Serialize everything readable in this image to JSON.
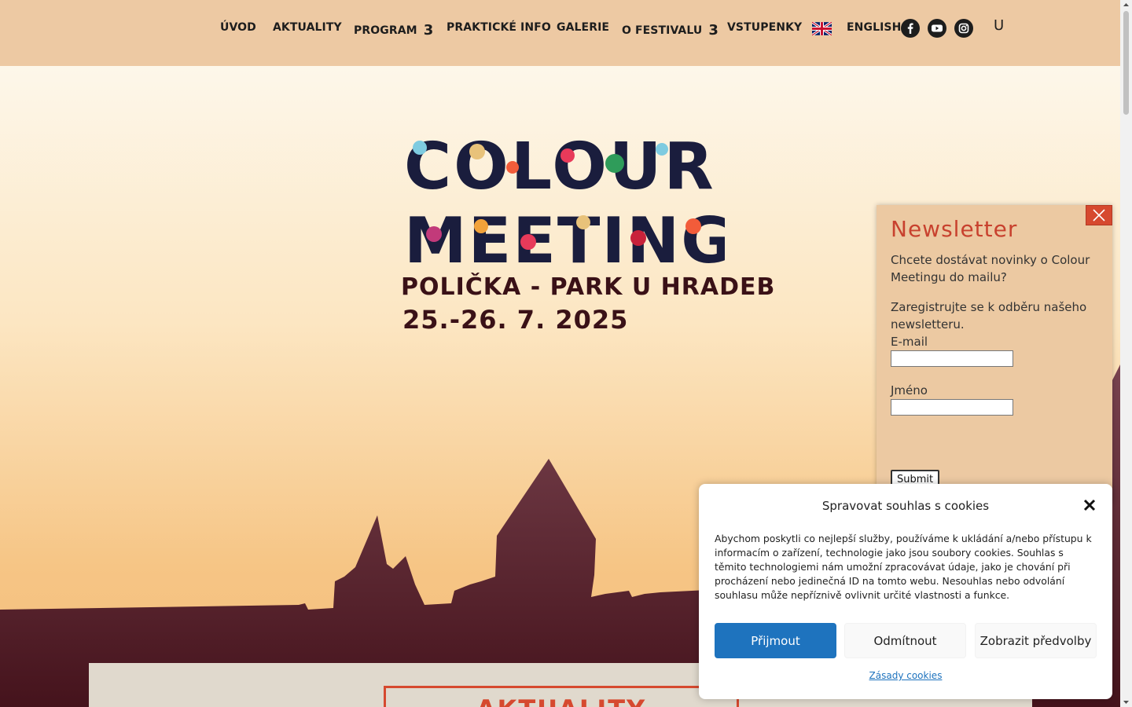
{
  "nav": {
    "items": [
      {
        "label": "ÚVOD"
      },
      {
        "label": "AKTUALITY"
      },
      {
        "label": "PROGRAM",
        "arrow": "3"
      },
      {
        "label": "PRAKTICKÉ INFO"
      },
      {
        "label": "GALERIE"
      },
      {
        "label": "O FESTIVALU",
        "arrow": "3"
      },
      {
        "label": "VSTUPENKY"
      },
      {
        "label": "ENGLISH"
      }
    ],
    "search_glyph": "U",
    "icons": [
      "uk-flag-icon",
      "facebook-icon",
      "youtube-icon",
      "instagram-icon"
    ]
  },
  "hero": {
    "logo_line1": "COLOUR",
    "logo_line2": "MEETING",
    "location": "POLIČKA - PARK U HRADEB",
    "dates": "25.-26. 7. 2025"
  },
  "section": {
    "heading": "AKTUALITY"
  },
  "newsletter": {
    "title": "Newsletter",
    "text1": "Chcete dostávat novinky o Colour Meetingu do mailu?",
    "text2": "Zaregistrujte se k odběru našeho newsletteru.",
    "email_label": "E-mail",
    "name_label": "Jméno",
    "submit_label": "Submit",
    "email_value": "",
    "name_value": ""
  },
  "cookie": {
    "title": "Spravovat souhlas s cookies",
    "body": "Abychom poskytli co nejlepší služby, používáme k ukládání a/nebo přístupu k informacím o zařízení, technologie jako jsou soubory cookies. Souhlas s těmito technologiemi nám umožní zpracovávat údaje, jako je chování při procházení nebo jedinečná ID na tomto webu. Nesouhlas nebo odvolání souhlasu může nepříznivě ovlivnit určité vlastnosti a funkce.",
    "accept_label": "Přijmout",
    "deny_label": "Odmítnout",
    "prefs_label": "Zobrazit předvolby",
    "policy_link": "Zásady cookies"
  },
  "colors": {
    "header_bg": "#edc9a3",
    "accent_red": "#d6492f",
    "dark_maroon": "#3a1117",
    "silhouette": "#5e2f3a",
    "cookie_accept": "#1e73be"
  }
}
